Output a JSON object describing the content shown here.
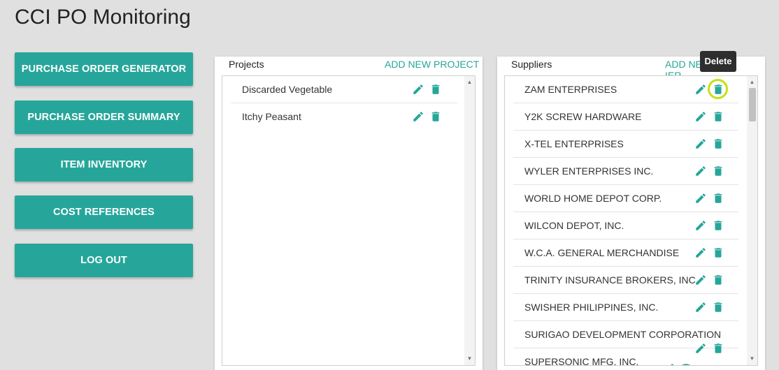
{
  "app": {
    "title": "CCI PO Monitoring"
  },
  "nav": {
    "purchase_order_generator": "PURCHASE ORDER GENERATOR",
    "purchase_order_summary": "PURCHASE ORDER SUMMARY",
    "item_inventory": "ITEM INVENTORY",
    "cost_references": "COST REFERENCES",
    "log_out": "LOG OUT"
  },
  "projects": {
    "title": "Projects",
    "add_label": "ADD NEW PROJECT",
    "items": [
      {
        "name": "Discarded Vegetable"
      },
      {
        "name": "Itchy Peasant"
      }
    ]
  },
  "suppliers": {
    "title": "Suppliers",
    "add_label_visible_start": "ADD NEW",
    "add_label_visible_end": "IER",
    "items": [
      {
        "name": "ZAM ENTERPRISES"
      },
      {
        "name": "Y2K SCREW HARDWARE"
      },
      {
        "name": "X-TEL ENTERPRISES"
      },
      {
        "name": "WYLER ENTERPRISES INC."
      },
      {
        "name": "WORLD HOME DEPOT CORP."
      },
      {
        "name": "WILCON DEPOT, INC."
      },
      {
        "name": "W.C.A. GENERAL MERCHANDISE"
      },
      {
        "name": "TRINITY INSURANCE BROKERS, INC"
      },
      {
        "name": "SWISHER PHILIPPINES, INC."
      },
      {
        "name": "SURIGAO DEVELOPMENT CORPORATION"
      },
      {
        "name": "SUPERSONIC MFG. INC."
      }
    ]
  },
  "tooltip": {
    "text": "Delete"
  },
  "icons": {
    "edit": "pencil-icon",
    "delete": "trash-icon"
  },
  "colors": {
    "accent": "#26a69a",
    "highlight": "#c6e010"
  }
}
